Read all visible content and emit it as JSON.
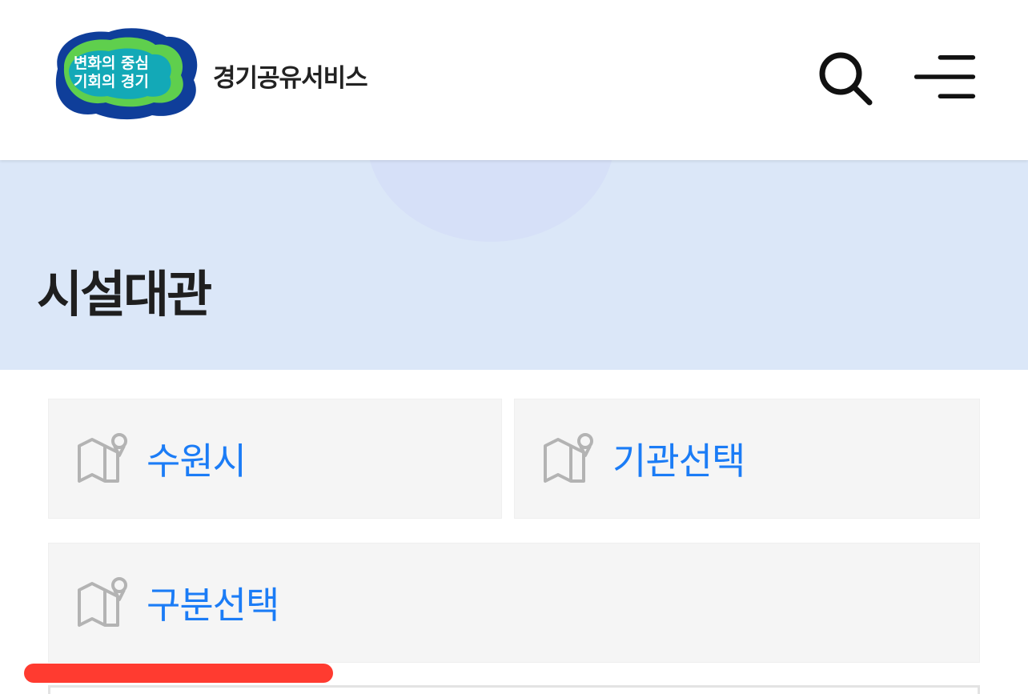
{
  "header": {
    "logo": {
      "line1": "변화의 중심",
      "line2": "기회의 경기",
      "colors": {
        "blue": "#0f3e9a",
        "green": "#5fcf4d",
        "teal": "#13a9b7"
      }
    },
    "brand": "경기공유서비스",
    "search_icon": "search-icon",
    "menu_icon": "hamburger-menu-icon"
  },
  "banner": {
    "title": "시설대관",
    "background": "#dbe7f8"
  },
  "filters": {
    "region": {
      "label": "수원시",
      "icon": "map-pin-icon"
    },
    "institution": {
      "label": "기관선택",
      "icon": "map-pin-icon"
    },
    "category": {
      "label": "구분선택",
      "icon": "map-pin-icon"
    }
  },
  "colors": {
    "accent": "#1b7cf6",
    "highlight": "#ff3b30"
  }
}
